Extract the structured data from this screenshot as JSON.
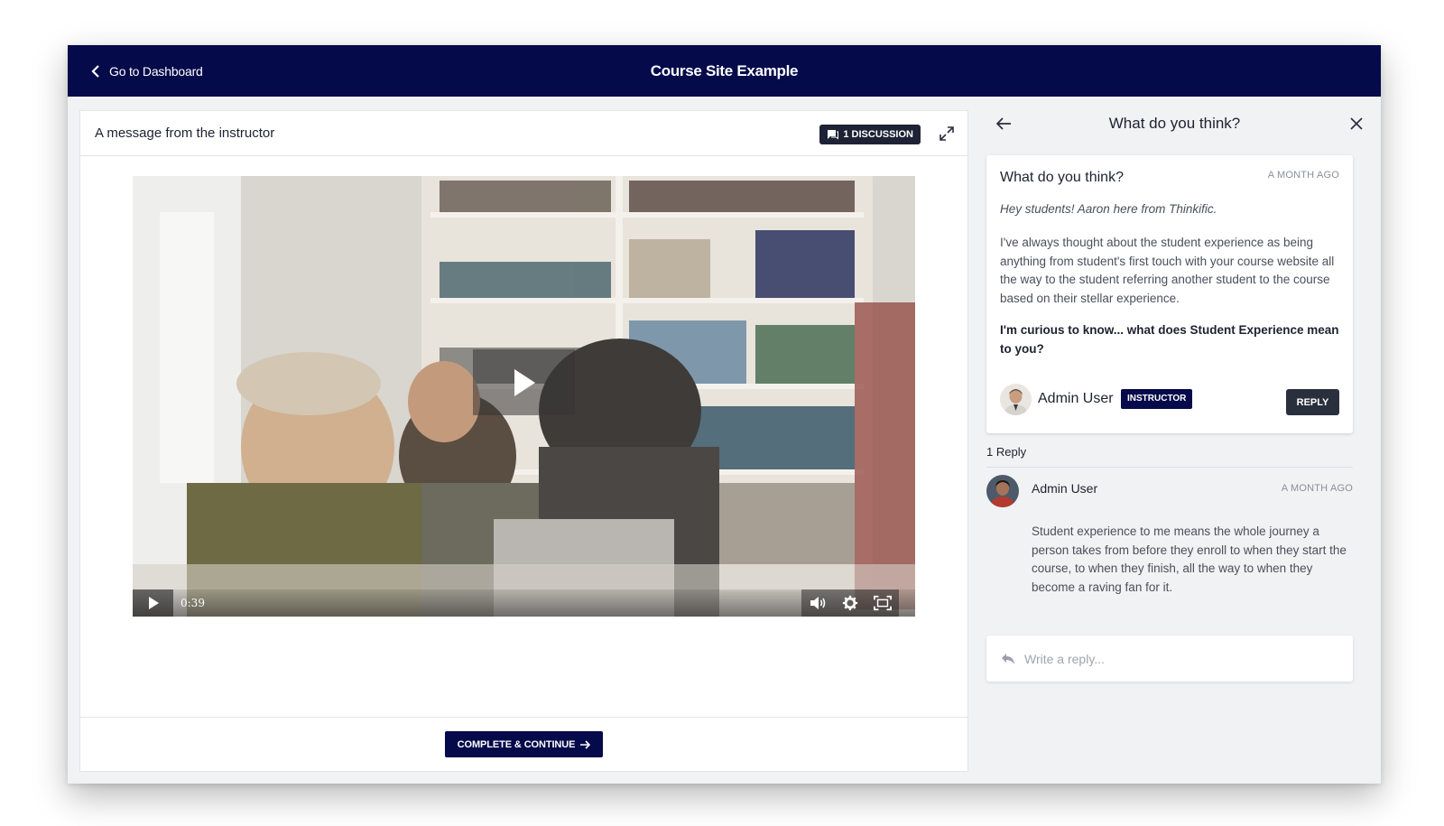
{
  "header": {
    "back_label": "Go to Dashboard",
    "site_title": "Course Site Example"
  },
  "lesson": {
    "title": "A message from the instructor",
    "discussion_button": "1 DISCUSSION",
    "video": {
      "time": "0:39"
    },
    "complete_button": "COMPLETE & CONTINUE"
  },
  "discussion": {
    "panel_title": "What do you think?",
    "post": {
      "title": "What do you think?",
      "time": "A MONTH AGO",
      "intro": "Hey students! Aaron here from Thinkific.",
      "body": "I've always thought about the student experience as being anything from student's first touch with your course website all the way to the student referring another student to the course based on their stellar experience.",
      "question": "I'm curious to know... what does Student Experience mean to you?",
      "author": "Admin User",
      "badge": "INSTRUCTOR",
      "reply_button": "REPLY"
    },
    "reply_count": "1 Reply",
    "replies": [
      {
        "author": "Admin User",
        "time": "A MONTH AGO",
        "body": "Student experience to me means the whole journey a person takes from before they enroll to when they start the course, to when they finish, all the way to when they become a raving fan for it."
      }
    ],
    "reply_input": {
      "placeholder": "Write a reply...",
      "value": ""
    }
  },
  "icons": {
    "back": "chevron-left-icon",
    "discussion": "chat-bubble-icon",
    "expand": "expand-arrows-icon",
    "play": "play-icon",
    "volume": "volume-icon",
    "settings": "gear-icon",
    "fullscreen": "fullscreen-icon",
    "arrow_right": "arrow-right-icon",
    "arrow_left": "arrow-left-icon",
    "close": "close-icon",
    "reply": "reply-arrow-icon"
  },
  "colors": {
    "navy": "#040a4a",
    "badge_dark": "#1d2335",
    "sidebar_bg": "#f1f2f4"
  }
}
